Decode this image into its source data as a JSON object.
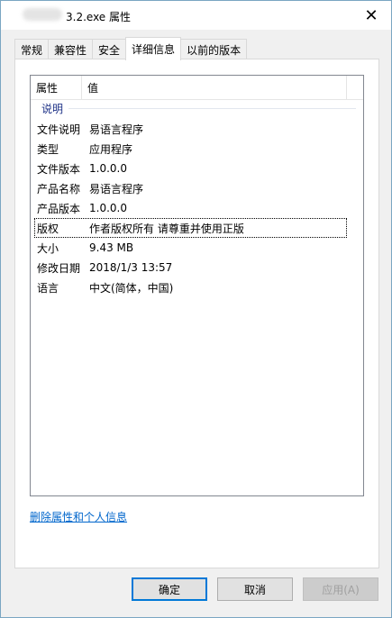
{
  "window": {
    "title": "3.2.exe 属性",
    "close_icon": "close-icon"
  },
  "tabs": [
    {
      "label": "常规",
      "active": false
    },
    {
      "label": "兼容性",
      "active": false
    },
    {
      "label": "安全",
      "active": false
    },
    {
      "label": "详细信息",
      "active": true
    },
    {
      "label": "以前的版本",
      "active": false
    }
  ],
  "list": {
    "headers": {
      "name": "属性",
      "value": "值"
    },
    "group": "说明",
    "rows": [
      {
        "name": "文件说明",
        "value": "易语言程序"
      },
      {
        "name": "类型",
        "value": "应用程序"
      },
      {
        "name": "文件版本",
        "value": "1.0.0.0"
      },
      {
        "name": "产品名称",
        "value": "易语言程序"
      },
      {
        "name": "产品版本",
        "value": "1.0.0.0"
      },
      {
        "name": "版权",
        "value": "作者版权所有 请尊重并使用正版"
      },
      {
        "name": "大小",
        "value": "9.43 MB"
      },
      {
        "name": "修改日期",
        "value": "2018/1/3 13:57"
      },
      {
        "name": "语言",
        "value": "中文(简体，中国)"
      }
    ]
  },
  "link": "删除属性和个人信息",
  "buttons": {
    "ok": "确定",
    "cancel": "取消",
    "apply": "应用(A)"
  }
}
